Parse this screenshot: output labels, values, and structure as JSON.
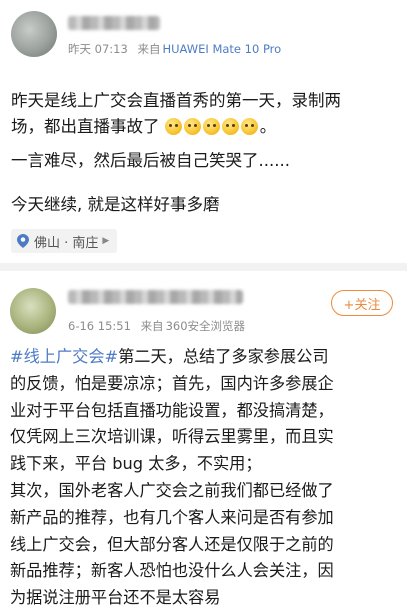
{
  "post1": {
    "time": "昨天 07:13",
    "source_prefix": "来自",
    "device": "HUAWEI Mate 10 Pro",
    "text_line1": "昨天是线上广交会直播首秀的第一天，录制两",
    "text_line2": "场，都出直播事故了",
    "text_line2_end": "。",
    "emojis": [
      "laugh-emoji",
      "laugh-emoji",
      "cry-emoji",
      "awkward-emoji",
      "awkward-emoji"
    ],
    "text_para2": "一言难尽，然后最后被自己笑哭了......",
    "text_para3": "今天继续, 就是这样好事多磨",
    "location": "佛山 · 南庄"
  },
  "post2": {
    "time": "6-16 15:51",
    "source_prefix": "来自",
    "device": "360安全浏览器",
    "follow_label": "+关注",
    "hashtag": "#线上广交会#",
    "lines": [
      "第二天，总结了多家参展公司",
      "的反馈，怕是要凉凉；首先，国内许多参展企",
      "业对于平台包括直播功能设置，都没搞清楚，",
      "仅凭网上三次培训课，听得云里雾里，而且实",
      "践下来，平台 bug 太多，不实用；",
      "其次，国外老客人广交会之前我们都已经做了",
      "新产品的推荐，也有几个客人来问是否有参加",
      "线上广交会，但大部分客人还是仅限于之前的",
      "新品推荐；新客人恐怕也没什么人会关注，因",
      "为据说注册平台还不是太容易"
    ]
  },
  "colors": {
    "link_blue": "#4e7cc4",
    "follow_orange": "#f08a3a",
    "meta_gray": "#8c8c8c"
  }
}
